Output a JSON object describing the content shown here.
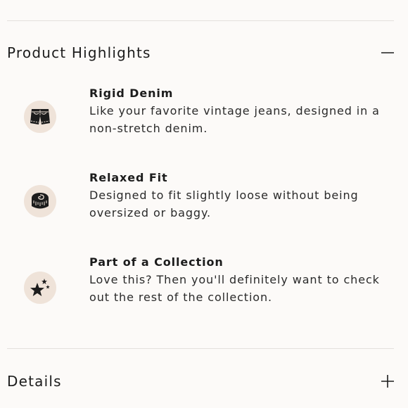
{
  "sections": {
    "highlights": {
      "title": "Product Highlights",
      "toggle_icon": "minus-icon",
      "items": [
        {
          "icon": "shorts-icon",
          "title": "Rigid Denim",
          "description": "Like your favorite vintage jeans, designed in a non-stretch denim."
        },
        {
          "icon": "tape-measure-icon",
          "title": "Relaxed Fit",
          "description": "Designed to fit slightly loose without being oversized or baggy."
        },
        {
          "icon": "stars-icon",
          "title": "Part of a Collection",
          "description": "Love this? Then you'll definitely want to check out the rest of the collection."
        }
      ]
    },
    "details": {
      "title": "Details",
      "toggle_icon": "plus-icon"
    }
  },
  "colors": {
    "background": "#fcfaf8",
    "icon_circle": "#efe3d9",
    "divider": "#e3e0dc",
    "text": "#1c1c1c"
  }
}
